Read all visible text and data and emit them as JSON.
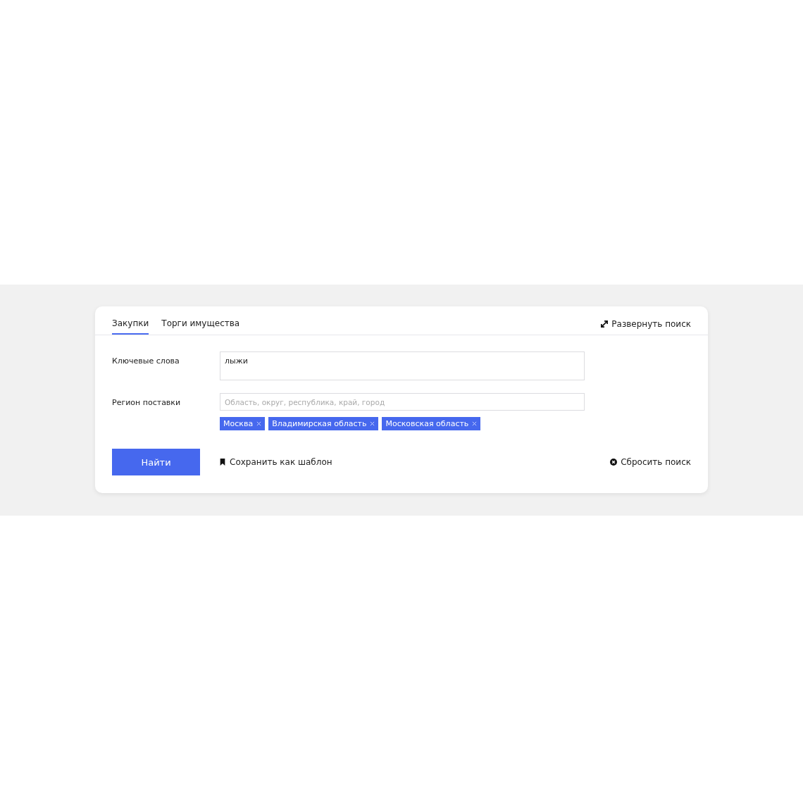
{
  "tabs": [
    {
      "label": "Закупки",
      "selected": true
    },
    {
      "label": "Торги имущества",
      "selected": false
    }
  ],
  "expand_link": "Развернуть поиск",
  "fields": [
    {
      "label": "Ключевые слова",
      "kind": "textarea",
      "value": "лыжи"
    },
    {
      "label": "Регион поставки",
      "kind": "input",
      "placeholder": "Область, округ, республика, край, город",
      "tags": [
        "Москва",
        "Владимирская область",
        "Московская область"
      ]
    }
  ],
  "submit_button": "Найти",
  "save_link": "Сохранить как шаблон",
  "reset_link": "Сбросить поиск"
}
